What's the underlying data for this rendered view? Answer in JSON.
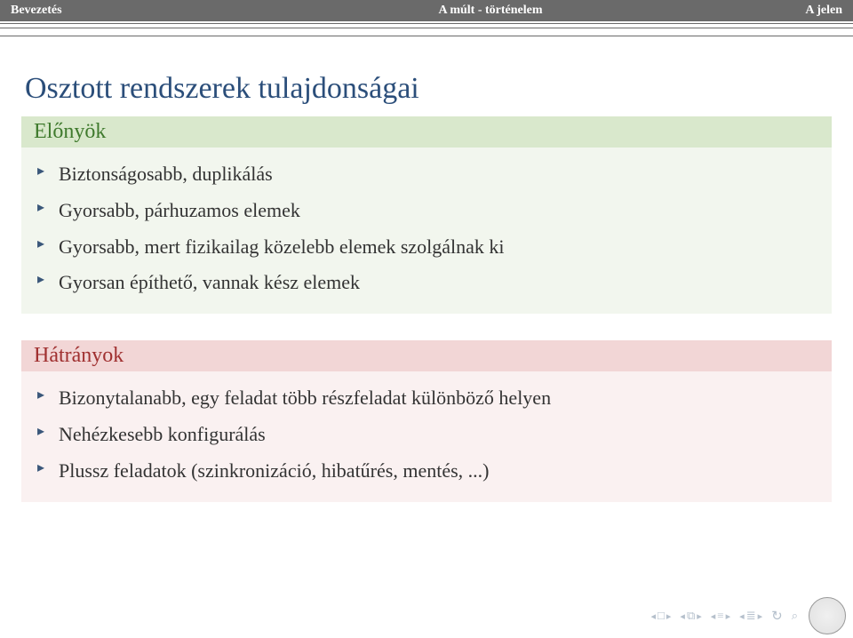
{
  "nav": {
    "left": "Bevezetés",
    "center": "A múlt - történelem",
    "right": "A jelen"
  },
  "title": "Osztott rendszerek tulajdonságai",
  "blocks": {
    "advantages": {
      "title": "Előnyök",
      "items": [
        "Biztonságosabb, duplikálás",
        "Gyorsabb, párhuzamos elemek",
        "Gyorsabb, mert fizikailag közelebb elemek szolgálnak ki",
        "Gyorsan építhető, vannak kész elemek"
      ]
    },
    "disadvantages": {
      "title": "Hátrányok",
      "items": [
        "Bizonytalanabb, egy feladat több részfeladat különböző helyen",
        "Nehézkesebb konfigurálás",
        "Plussz feladatok (szinkronizáció, hibatűrés, mentés, ...)"
      ]
    }
  },
  "footer": {
    "logo_label": ""
  }
}
